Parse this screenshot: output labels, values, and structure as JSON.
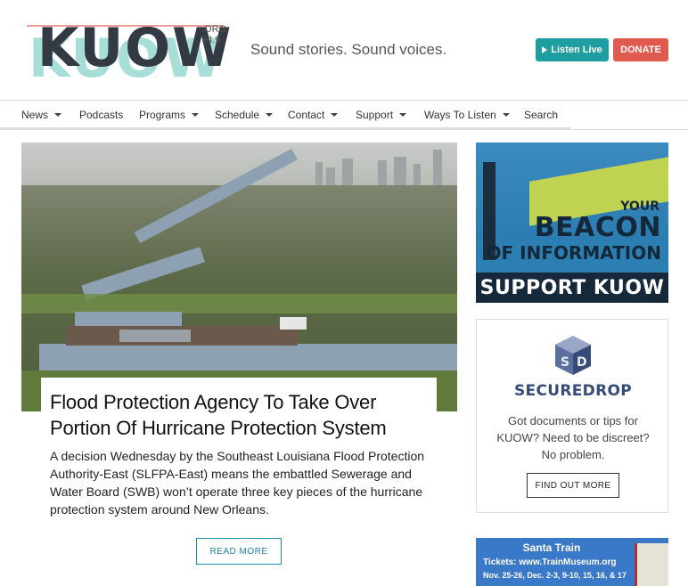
{
  "brand": {
    "logo_text": "KUOW",
    "logo_org": ".ORG",
    "logo_freq": "94.9",
    "tagline": "Sound stories. Sound voices."
  },
  "header": {
    "listen_label": "Listen Live",
    "donate_label": "DONATE"
  },
  "nav": {
    "items": [
      {
        "label": "News",
        "dropdown": true
      },
      {
        "label": "Podcasts",
        "dropdown": false
      },
      {
        "label": "Programs",
        "dropdown": true
      },
      {
        "label": "Schedule",
        "dropdown": true
      },
      {
        "label": "Contact",
        "dropdown": true
      },
      {
        "label": "Support",
        "dropdown": true
      },
      {
        "label": "Ways To Listen",
        "dropdown": true
      },
      {
        "label": "Search",
        "dropdown": false
      }
    ]
  },
  "story": {
    "headline": "Flood Protection Agency To Take Over Portion Of Hurricane Protection System",
    "summary": "A decision Wednesday by the Southeast Louisiana Flood Protection Authority-East (SLFPA-East) means the embattled Sewerage and Water Board (SWB) won’t operate three key pieces of the hurricane protection system around New Orleans.",
    "read_more": "READ MORE"
  },
  "sidebar": {
    "beacon": {
      "line1": "YOUR",
      "line2": "BEACON",
      "line3": "OF INFORMATION",
      "cta": "SUPPORT KUOW"
    },
    "securedrop": {
      "title": "SECUREDROP",
      "text": "Got documents or tips for KUOW? Need to be discreet? No problem.",
      "button": "FIND OUT MORE"
    },
    "santa": {
      "title": "Santa Train",
      "tickets": "Tickets: www.TrainMuseum.org",
      "dates": "Nov. 25-26, Dec. 2-3, 9-10, 15, 16, & 17"
    }
  },
  "colors": {
    "teal": "#1e9ea0",
    "donate_red": "#e05a4e",
    "securedrop_blue": "#374b79"
  }
}
